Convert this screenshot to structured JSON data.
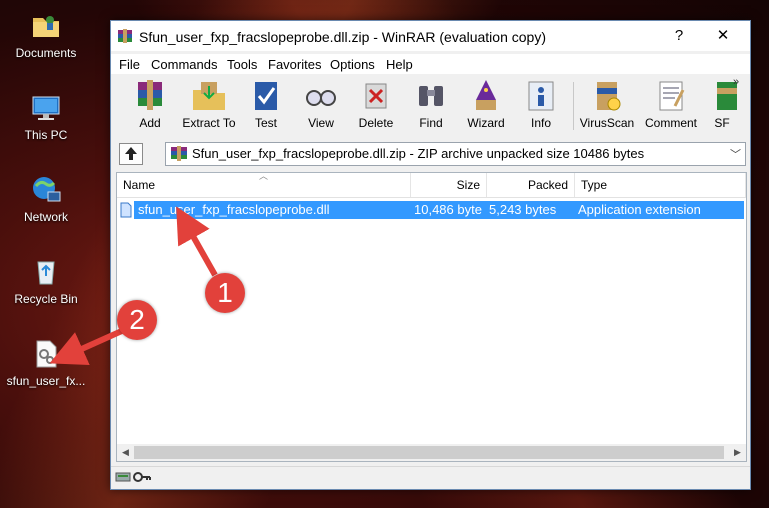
{
  "desktop": {
    "icons": [
      {
        "label": "Documents"
      },
      {
        "label": "This PC"
      },
      {
        "label": "Network"
      },
      {
        "label": "Recycle Bin"
      },
      {
        "label": "sfun_user_fx..."
      }
    ]
  },
  "window": {
    "title": "Sfun_user_fxp_fracslopeprobe.dll.zip - WinRAR (evaluation copy)",
    "help_button": "?",
    "close_button": "✕"
  },
  "menu": [
    "File",
    "Commands",
    "Tools",
    "Favorites",
    "Options",
    "Help"
  ],
  "toolbar": {
    "tools": [
      "Add",
      "Extract To",
      "Test",
      "View",
      "Delete",
      "Find",
      "Wizard",
      "Info",
      "VirusScan",
      "Comment",
      "SF"
    ],
    "more": "»"
  },
  "address": {
    "text": "Sfun_user_fxp_fracslopeprobe.dll.zip - ZIP archive unpacked size 10486 bytes"
  },
  "columns": {
    "name": "Name",
    "size": "Size",
    "packed": "Packed",
    "type": "Type"
  },
  "files": [
    {
      "name": "sfun_user_fxp_fracslopeprobe.dll",
      "size": "10,486 byte",
      "packed": "5,243 bytes",
      "type": "Application extension"
    }
  ],
  "annotations": [
    "1",
    "2"
  ],
  "colors": {
    "selection": "#3399ff",
    "annotation": "#e2413b"
  }
}
